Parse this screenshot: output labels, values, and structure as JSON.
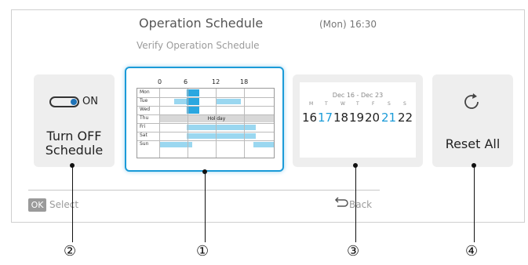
{
  "header": {
    "title": "Operation Schedule",
    "subtitle": "Verify Operation Schedule",
    "time": "(Mon) 16:30"
  },
  "card_toggle": {
    "state": "ON",
    "label_line1": "Turn OFF",
    "label_line2": "Schedule"
  },
  "card_schedule": {
    "hours": [
      "0",
      "6",
      "12",
      "18"
    ],
    "days": [
      "Mon",
      "Tue",
      "Wed",
      "Thu",
      "Fri",
      "Sat",
      "Sun"
    ],
    "holiday_label": "Holiday"
  },
  "card_calendar": {
    "range": "Dec 16 - Dec 23",
    "weekdays": [
      "M",
      "T",
      "W",
      "T",
      "F",
      "S",
      "S"
    ],
    "dates": [
      "16",
      "17",
      "18",
      "19",
      "20",
      "21",
      "22"
    ]
  },
  "card_reset": {
    "label": "Reset All"
  },
  "footer": {
    "ok_key": "OK",
    "select_label": "Select",
    "back_label": "Back"
  },
  "callouts": [
    "②",
    "①",
    "③",
    "④"
  ],
  "colors": {
    "accent": "#1b9bd8",
    "bar": "#9ad7f0",
    "bar_selected": "#2aa7e0"
  }
}
